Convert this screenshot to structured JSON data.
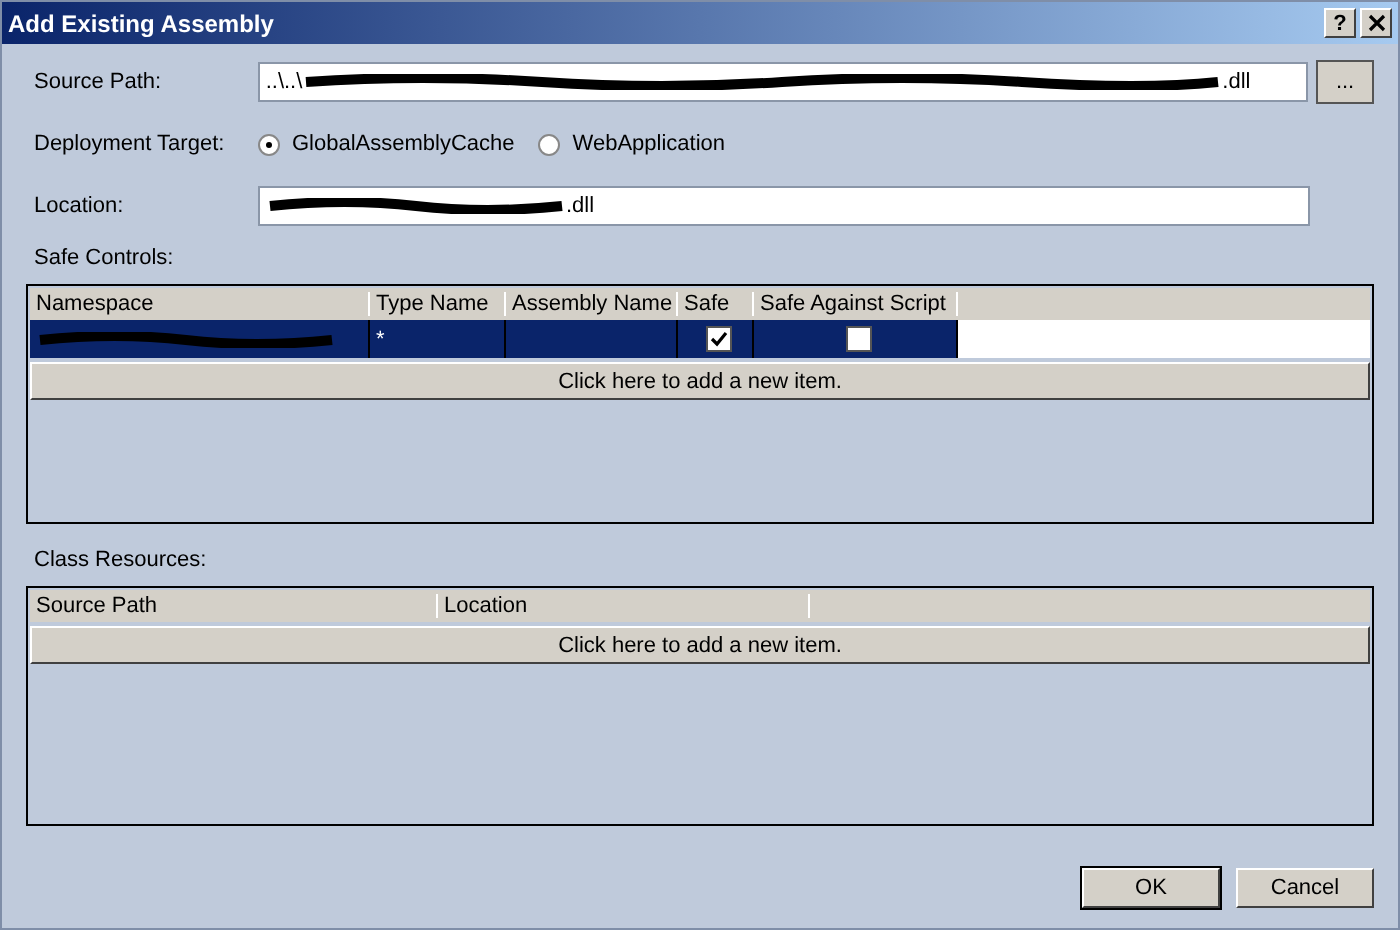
{
  "window": {
    "title": "Add Existing Assembly",
    "help": "?"
  },
  "source_path": {
    "label": "Source Path:",
    "value_start": "..\\..\\",
    "redacted": true,
    "value_end": ".dll",
    "browse": "..."
  },
  "deployment_target": {
    "label": "Deployment Target:",
    "options": [
      {
        "label": "GlobalAssemblyCache",
        "selected": true
      },
      {
        "label": "WebApplication",
        "selected": false
      }
    ]
  },
  "location": {
    "label": "Location:",
    "redacted": true,
    "value_end": ".dll"
  },
  "safe_controls": {
    "label": "Safe Controls:",
    "columns": [
      "Namespace",
      "Type Name",
      "Assembly Name",
      "Safe",
      "Safe Against Script"
    ],
    "rows": [
      {
        "namespace_redacted": true,
        "type_name": "*",
        "safe": true,
        "safe_against_script": false,
        "selected": true
      }
    ],
    "add_item": "Click here to add a new item."
  },
  "class_resources": {
    "label": "Class Resources:",
    "columns": [
      "Source Path",
      "Location"
    ],
    "add_item": "Click here to add a new item."
  },
  "buttons": [
    "OK",
    "Cancel"
  ]
}
